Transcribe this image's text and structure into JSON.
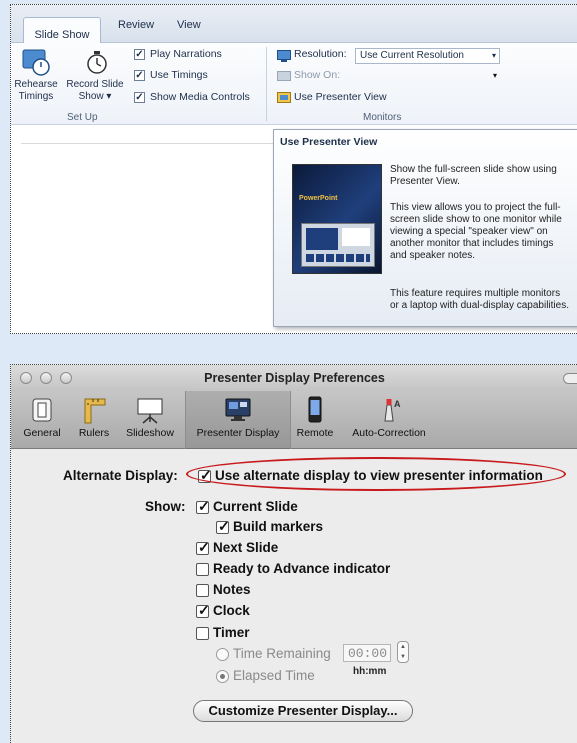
{
  "ribbon": {
    "tabs": [
      "Slide Show",
      "Review",
      "View"
    ],
    "rehearse": {
      "line1": "Rehearse",
      "line2": "Timings"
    },
    "record": {
      "line1": "Record Slide",
      "line2": "Show ▾"
    },
    "setup_checks": [
      {
        "label": "Play Narrations",
        "checked": true
      },
      {
        "label": "Use Timings",
        "checked": true
      },
      {
        "label": "Show Media Controls",
        "checked": true
      }
    ],
    "setup_group": "Set Up",
    "resolution_label": "Resolution:",
    "resolution_value": "Use Current Resolution",
    "show_on_label": "Show On:",
    "use_presenter_label": "Use Presenter View",
    "monitors_group": "Monitors"
  },
  "tooltip": {
    "title": "Use Presenter View",
    "p1": "Show the full-screen slide show using Presenter View.",
    "p2": "This view allows you to project the full-screen slide show to one monitor while viewing a special \"speaker view\" on another monitor that includes timings and speaker notes.",
    "p3": "This feature requires multiple monitors or a laptop with dual-display capabilities.",
    "thumb_text": "PowerPoint"
  },
  "prefs": {
    "window_title": "Presenter Display Preferences",
    "toolbar": [
      {
        "label": "General",
        "icon": "switch-icon"
      },
      {
        "label": "Rulers",
        "icon": "ruler-icon"
      },
      {
        "label": "Slideshow",
        "icon": "projector-screen-icon"
      },
      {
        "label": "Presenter Display",
        "icon": "monitor-icon",
        "selected": true
      },
      {
        "label": "Remote",
        "icon": "phone-icon"
      },
      {
        "label": "Auto-Correction",
        "icon": "autocorrect-icon"
      }
    ],
    "alternate_label": "Alternate Display:",
    "alternate_option": "Use alternate display to view presenter information",
    "alternate_checked": true,
    "show_label": "Show:",
    "show_options": [
      {
        "label": "Current Slide",
        "checked": true
      },
      {
        "label": "Build markers",
        "checked": true
      },
      {
        "label": "Next Slide",
        "checked": true
      },
      {
        "label": "Ready to Advance indicator",
        "checked": false
      },
      {
        "label": "Notes",
        "checked": false
      },
      {
        "label": "Clock",
        "checked": true
      },
      {
        "label": "Timer",
        "checked": false
      }
    ],
    "time_remaining_label": "Time Remaining",
    "time_value": "00:00",
    "time_format": "hh:mm",
    "elapsed_label": "Elapsed Time",
    "elapsed_selected": true,
    "customize_button": "Customize Presenter Display..."
  },
  "colors": {
    "highlight_oval": "#c8191c",
    "ribbon_text": "#1e2f4a"
  }
}
